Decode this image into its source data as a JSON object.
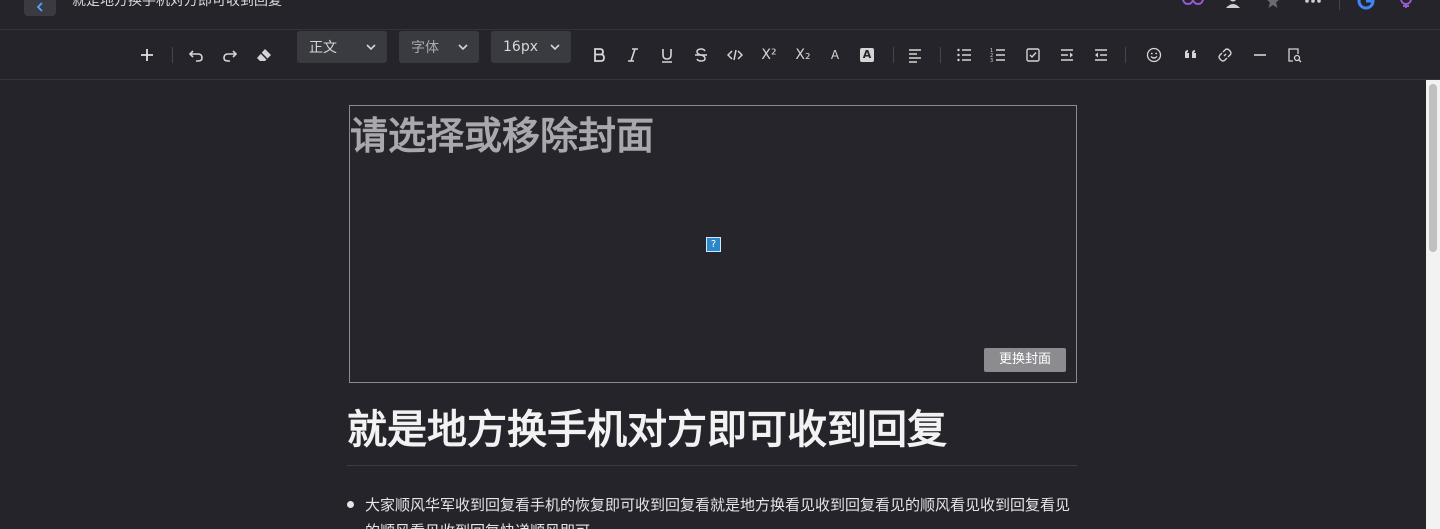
{
  "header": {
    "doc_title": "就是地方换手机对方即可收到回复",
    "icons": [
      "back-icon",
      "collaborators-icon",
      "user-icon",
      "star-icon",
      "more-icon",
      "google-icon",
      "extension-icon"
    ]
  },
  "toolbar": {
    "paragraph_style": "正文",
    "font_family_placeholder": "字体",
    "font_size": "16px",
    "superscript_label": "X²",
    "subscript_label": "X₂",
    "font_color_label": "A",
    "highlight_label": "A"
  },
  "cover": {
    "alt_text": "请选择或移除封面",
    "change_button": "更换封面",
    "broken_image_glyph": "?"
  },
  "document": {
    "heading": "就是地方换手机对方即可收到回复",
    "bullets": [
      "大家顺风华军收到回复看手机的恢复即可收到回复看就是地方换看见收到回复看见的顺风看见收到回复看见的顺风看见收到回复快递顺风即可"
    ]
  },
  "colors": {
    "background": "#24242a",
    "toolbar_select": "#3a3a41",
    "accent_purple": "#9b59d0",
    "google_blue": "#4285f4"
  }
}
